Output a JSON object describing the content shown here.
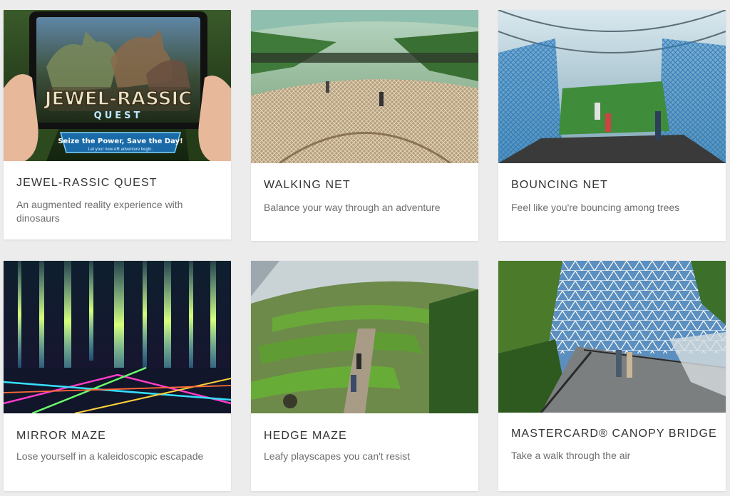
{
  "attractions": [
    {
      "title": "JEWEL-RASSIC QUEST",
      "description": "An augmented reality experience with dinosaurs",
      "image": {
        "logo_line1": "JEWEL-RASSIC",
        "logo_line2": "QUEST",
        "banner_line1": "Seize the Power, Save the Day!",
        "banner_line2": "Let your new AR adventure begin."
      }
    },
    {
      "title": "WALKING NET",
      "description": "Balance your way through an adventure"
    },
    {
      "title": "BOUNCING NET",
      "description": "Feel like you're bouncing among trees"
    },
    {
      "title": "MIRROR MAZE",
      "description": "Lose yourself in a kaleidoscopic escapade"
    },
    {
      "title": "HEDGE MAZE",
      "description": "Leafy playscapes you can't resist"
    },
    {
      "title": "MASTERCARD® CANOPY BRIDGE",
      "description": "Take a walk through the air"
    }
  ]
}
